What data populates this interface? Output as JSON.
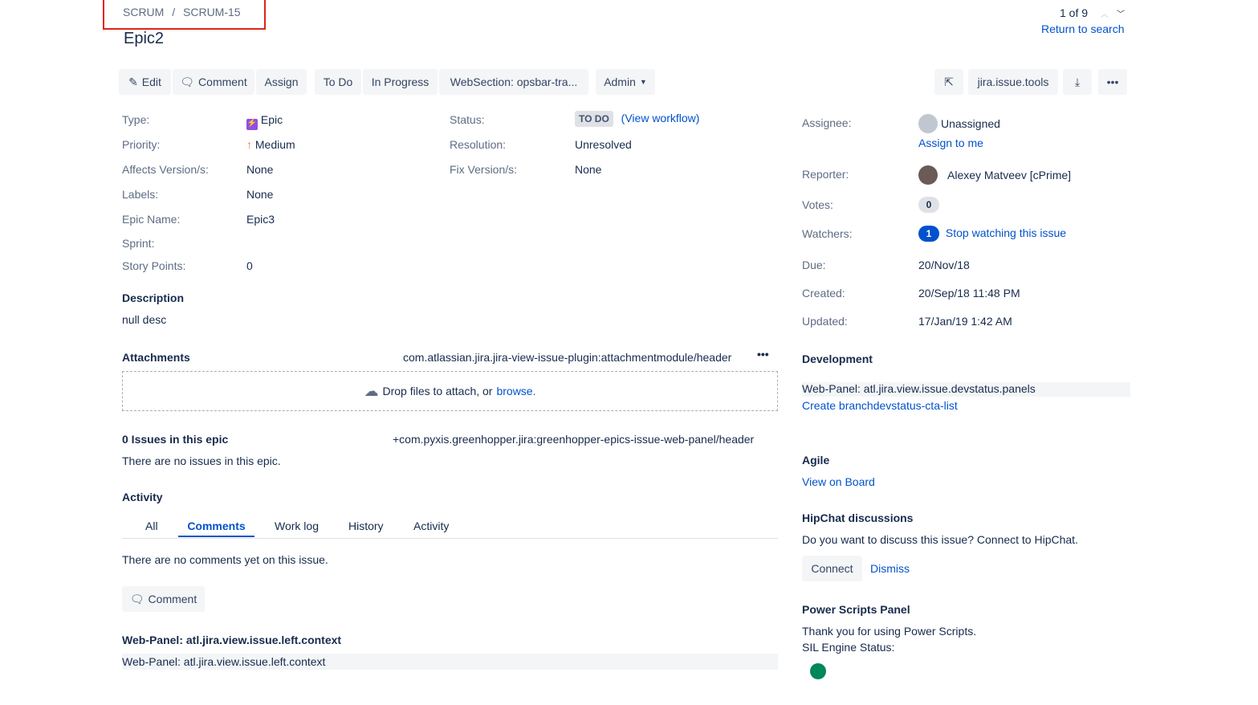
{
  "breadcrumb": {
    "project": "SCRUM",
    "sep": "/",
    "issue": "SCRUM-15"
  },
  "title": "Epic2",
  "pager": {
    "text": "1 of 9",
    "return": "Return to search"
  },
  "toolbar": {
    "edit": "Edit",
    "comment": "Comment",
    "assign": "Assign",
    "todo": "To Do",
    "inprogress": "In Progress",
    "websection": "WebSection: opsbar-tra...",
    "admin": "Admin",
    "tools": "jira.issue.tools"
  },
  "details": {
    "type": {
      "label": "Type:",
      "value": "Epic"
    },
    "priority": {
      "label": "Priority:",
      "value": "Medium"
    },
    "affects": {
      "label": "Affects Version/s:",
      "value": "None"
    },
    "labels": {
      "label": "Labels:",
      "value": "None"
    },
    "epicname": {
      "label": "Epic Name:",
      "value": "Epic3"
    },
    "sprint": {
      "label": "Sprint:"
    },
    "points": {
      "label": "Story Points:",
      "value": "0"
    },
    "status": {
      "label": "Status:",
      "value": "TO DO",
      "workflow": "(View workflow)"
    },
    "resolution": {
      "label": "Resolution:",
      "value": "Unresolved"
    },
    "fix": {
      "label": "Fix Version/s:",
      "value": "None"
    }
  },
  "description": {
    "heading": "Description",
    "text": "null desc"
  },
  "attachments": {
    "heading": "Attachments",
    "header": "com.atlassian.jira.jira-view-issue-plugin:attachmentmodule/header",
    "drop": "Drop files to attach, or",
    "browse": "browse."
  },
  "epic": {
    "heading": "0 Issues in this epic",
    "header": "+com.pyxis.greenhopper.jira:greenhopper-epics-issue-web-panel/header",
    "text": "There are no issues in this epic."
  },
  "activity": {
    "heading": "Activity",
    "tabs": [
      "All",
      "Comments",
      "Work log",
      "History",
      "Activity"
    ],
    "empty": "There are no comments yet on this issue.",
    "comment": "Comment"
  },
  "leftpanel": {
    "heading": "Web-Panel: atl.jira.view.issue.left.context",
    "text": "Web-Panel: atl.jira.view.issue.left.context"
  },
  "people": {
    "assignee": {
      "label": "Assignee:",
      "value": "Unassigned",
      "action": "Assign to me"
    },
    "reporter": {
      "label": "Reporter:",
      "value": "Alexey Matveev [cPrime]"
    },
    "votes": {
      "label": "Votes:",
      "value": "0"
    },
    "watchers": {
      "label": "Watchers:",
      "value": "1",
      "action": "Stop watching this issue"
    },
    "due": {
      "label": "Due:",
      "value": "20/Nov/18"
    },
    "created": {
      "label": "Created:",
      "value": "20/Sep/18 11:48 PM"
    },
    "updated": {
      "label": "Updated:",
      "value": "17/Jan/19 1:42 AM"
    }
  },
  "development": {
    "heading": "Development",
    "panel": "Web-Panel: atl.jira.view.issue.devstatus.panels",
    "link": "Create branchdevstatus-cta-list"
  },
  "agile": {
    "heading": "Agile",
    "link": "View on Board"
  },
  "hipchat": {
    "heading": "HipChat discussions",
    "text": "Do you want to discuss this issue? Connect to HipChat.",
    "connect": "Connect",
    "dismiss": "Dismiss"
  },
  "power": {
    "heading": "Power Scripts Panel",
    "line1": "Thank you for using Power Scripts.",
    "line2": "SIL Engine Status:",
    "status_color": "#00875a"
  }
}
